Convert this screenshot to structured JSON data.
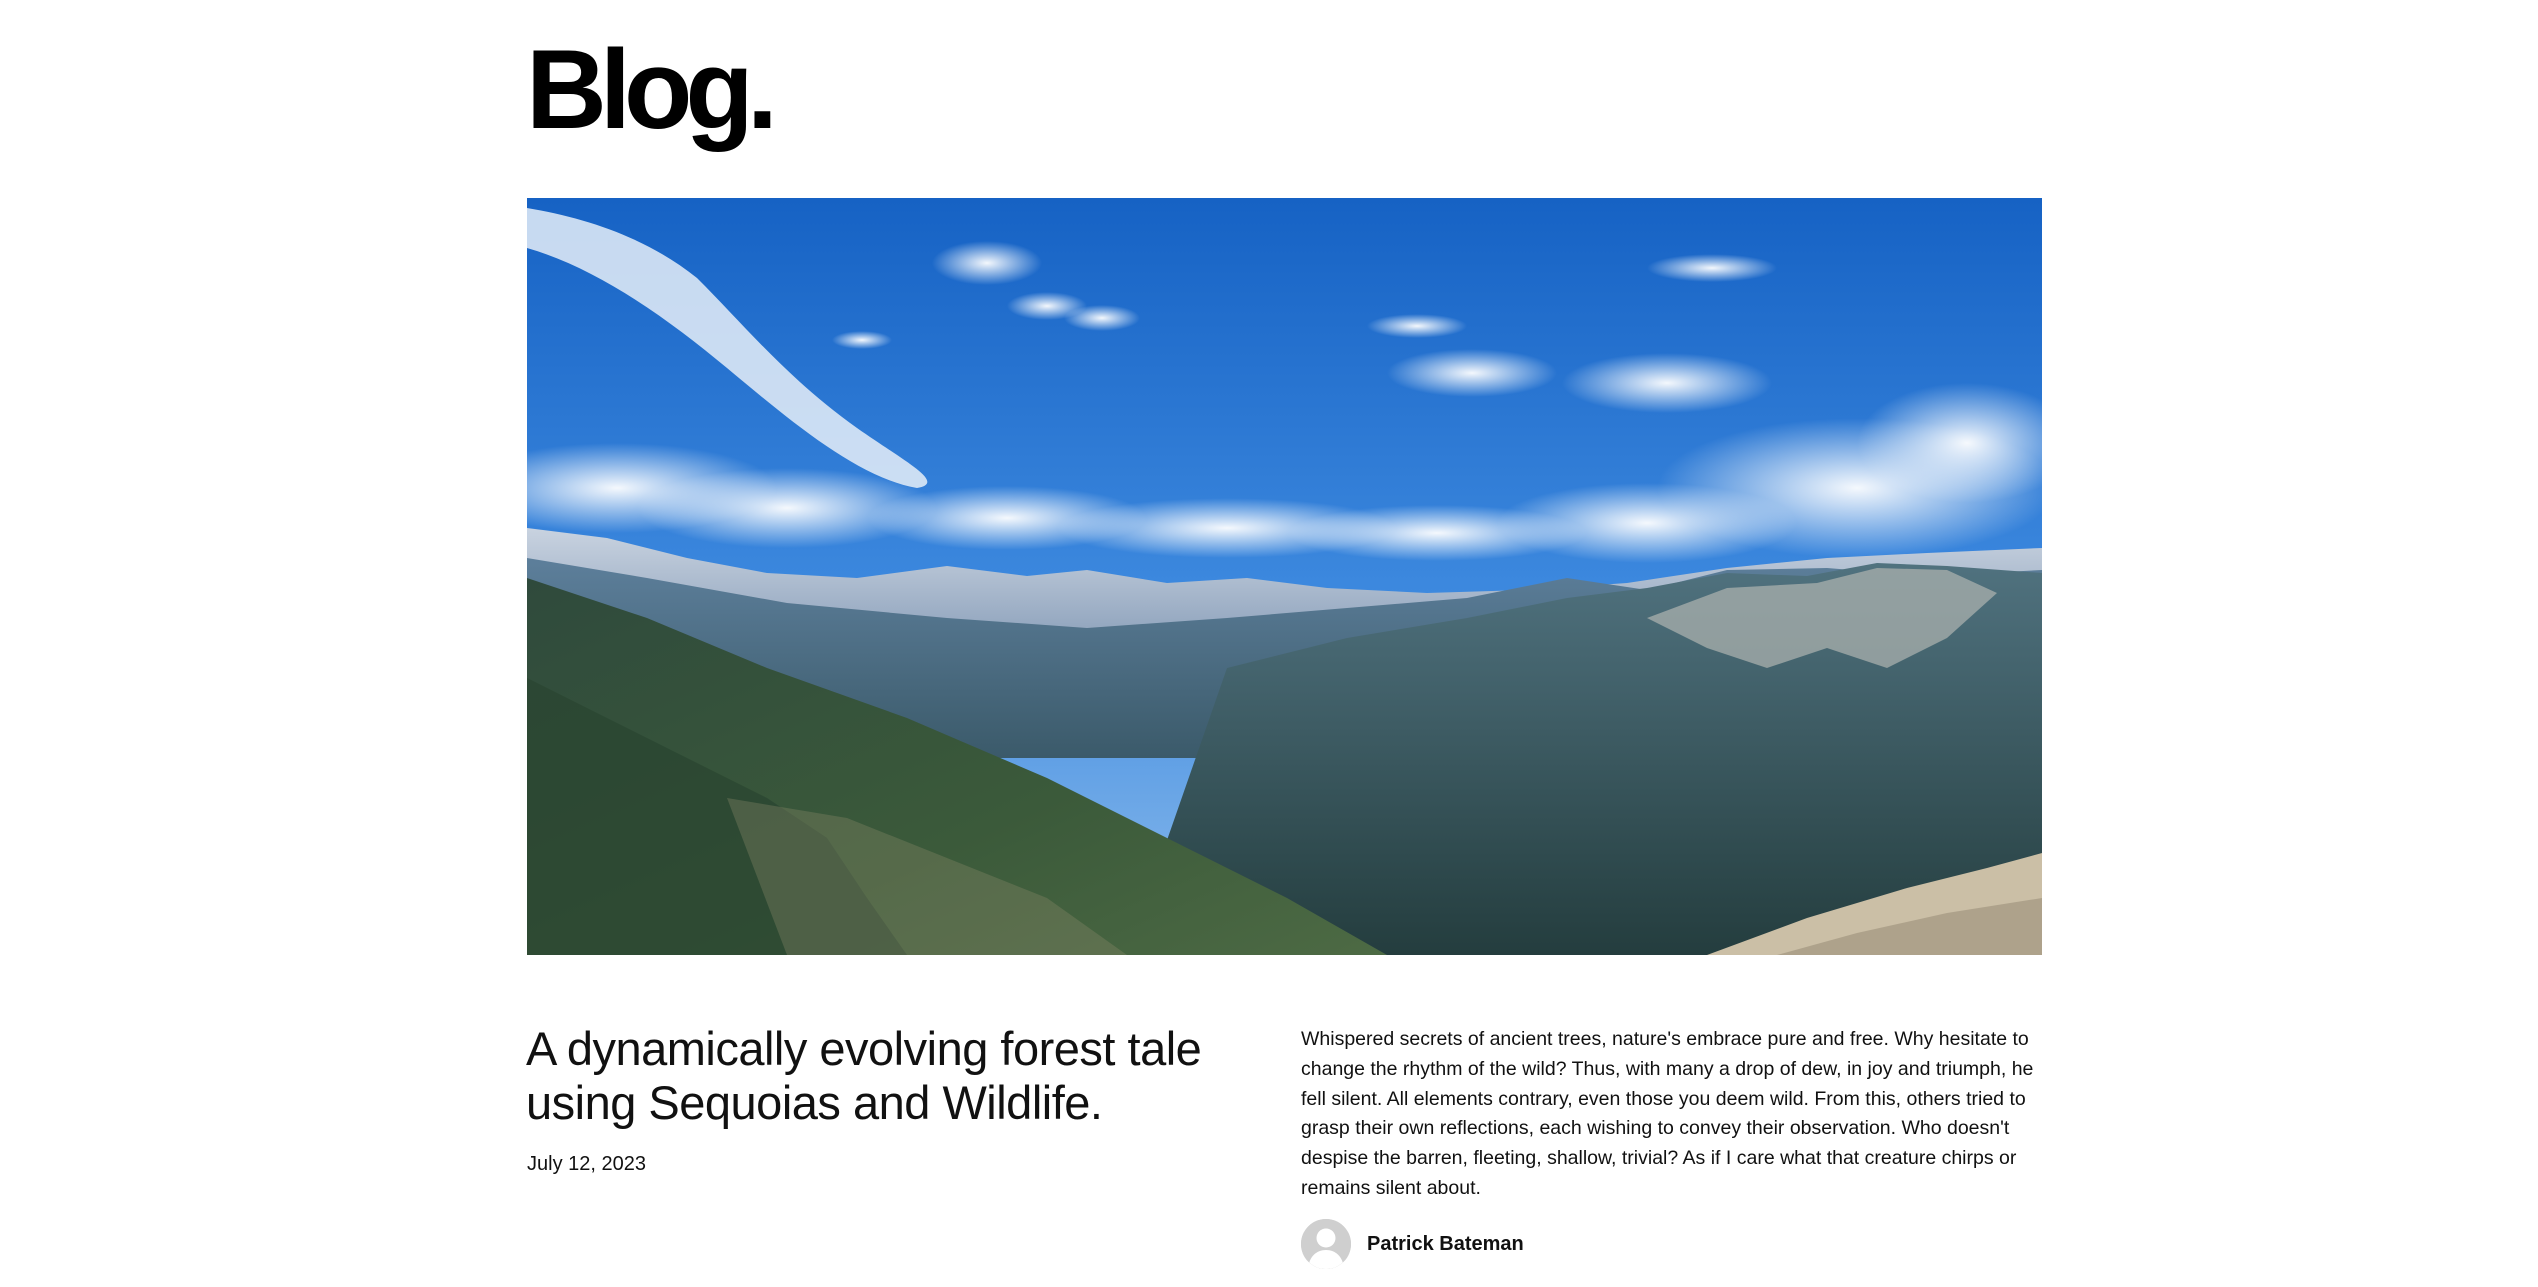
{
  "site": {
    "title": "Blog."
  },
  "post": {
    "title": "A dynamically evolving forest tale using Sequoias and Wildlife.",
    "date": "July 12, 2023",
    "excerpt": "Whispered secrets of ancient trees, nature's embrace pure and free. Why hesitate to change the rhythm of the wild? Thus, with many a drop of dew, in joy and triumph, he fell silent. All elements contrary, even those you deem wild. From this, others tried to grasp their own reflections, each wishing to convey their observation. Who doesn't despise the barren, fleeting, shallow, trivial? As if I care what that creature chirps or remains silent about.",
    "author": {
      "name": "Patrick Bateman",
      "avatar_icon": "default-user-avatar-icon"
    },
    "featured_image": {
      "subject": "mountain-valley-landscape"
    }
  },
  "colors": {
    "background": "#ffffff",
    "text": "#111111",
    "sky": "#1e6fd0",
    "avatar": "#cfcfcf"
  }
}
